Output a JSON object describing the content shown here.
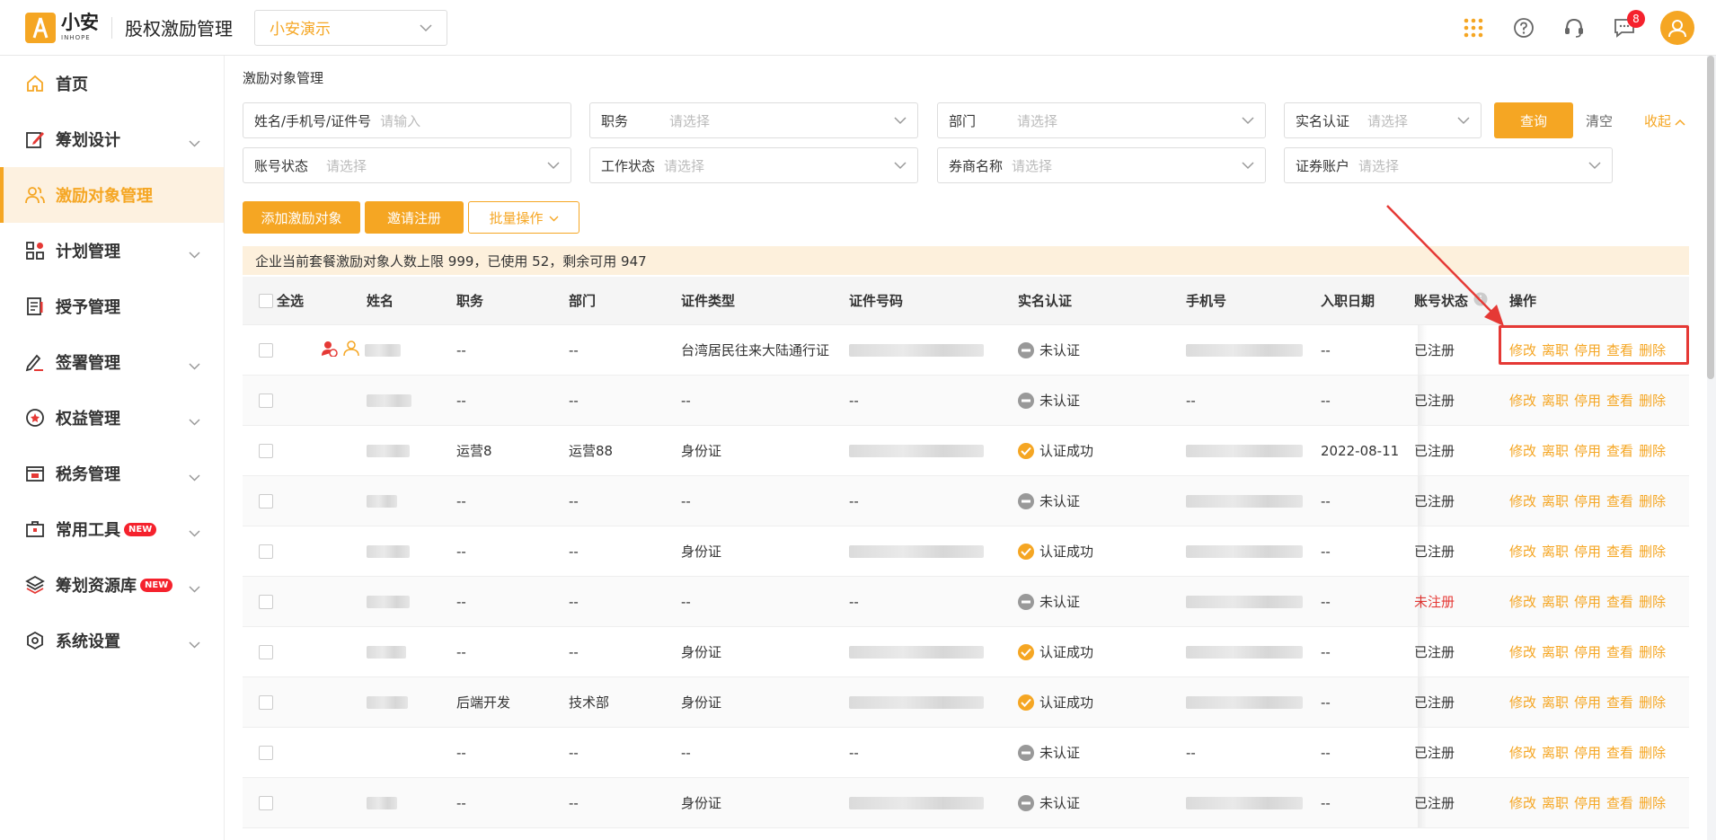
{
  "topbar": {
    "logo_cn": "小安",
    "logo_en": "INHOPE",
    "app_title": "股权激励管理",
    "company": "小安演示",
    "message_count": "8"
  },
  "sidebar": {
    "items": [
      {
        "label": "首页",
        "icon": "home-icon",
        "has_chevron": false,
        "active": false
      },
      {
        "label": "筹划设计",
        "icon": "edit-icon",
        "has_chevron": true,
        "active": false
      },
      {
        "label": "激励对象管理",
        "icon": "users-icon",
        "has_chevron": false,
        "active": true
      },
      {
        "label": "计划管理",
        "icon": "grid-icon",
        "has_chevron": true,
        "active": false
      },
      {
        "label": "授予管理",
        "icon": "document-icon",
        "has_chevron": false,
        "active": false
      },
      {
        "label": "签署管理",
        "icon": "sign-icon",
        "has_chevron": true,
        "active": false
      },
      {
        "label": "权益管理",
        "icon": "star-badge-icon",
        "has_chevron": true,
        "active": false
      },
      {
        "label": "税务管理",
        "icon": "tax-icon",
        "has_chevron": true,
        "active": false
      },
      {
        "label": "常用工具",
        "icon": "toolbox-icon",
        "has_chevron": true,
        "active": false,
        "badge": "NEW"
      },
      {
        "label": "筹划资源库",
        "icon": "layers-icon",
        "has_chevron": true,
        "active": false,
        "badge": "NEW"
      },
      {
        "label": "系统设置",
        "icon": "settings-icon",
        "has_chevron": true,
        "active": false
      }
    ]
  },
  "main": {
    "breadcrumb": "激励对象管理",
    "filters": {
      "name": {
        "label": "姓名/手机号/证件号",
        "placeholder": "请输入"
      },
      "position": {
        "label": "职务",
        "placeholder": "请选择"
      },
      "department": {
        "label": "部门",
        "placeholder": "请选择"
      },
      "realname": {
        "label": "实名认证",
        "placeholder": "请选择"
      },
      "account_status": {
        "label": "账号状态",
        "placeholder": "请选择"
      },
      "work_status": {
        "label": "工作状态",
        "placeholder": "请选择"
      },
      "broker": {
        "label": "券商名称",
        "placeholder": "请选择"
      },
      "securities_account": {
        "label": "证券账户",
        "placeholder": "请选择"
      }
    },
    "query_label": "查询",
    "clear_label": "清空",
    "collapse_label": "收起",
    "actions": {
      "add": "添加激励对象",
      "invite": "邀请注册",
      "batch": "批量操作"
    },
    "notice": "企业当前套餐激励对象人数上限 999，已使用 52，剩余可用 947",
    "table": {
      "headers": {
        "select_all": "全选",
        "name": "姓名",
        "position": "职务",
        "department": "部门",
        "id_type": "证件类型",
        "id_number": "证件号码",
        "realname": "实名认证",
        "phone": "手机号",
        "join_date": "入职日期",
        "account_status": "账号状态",
        "ops": "操作"
      },
      "op_labels": {
        "edit": "修改",
        "leave": "离职",
        "disable": "停用",
        "view": "查看",
        "delete": "删除"
      },
      "rows": [
        {
          "position": "--",
          "department": "--",
          "id_type": "台湾居民往来大陆通行证",
          "id_number": "",
          "realname": "未认证",
          "verified": false,
          "phone": "",
          "join_date": "--",
          "account_status": "已注册",
          "registered": true,
          "special_icons": true
        },
        {
          "position": "--",
          "department": "--",
          "id_type": "--",
          "id_number": "--",
          "realname": "未认证",
          "verified": false,
          "phone": "--",
          "join_date": "--",
          "account_status": "已注册",
          "registered": true
        },
        {
          "position": "运营8",
          "department": "运营88",
          "id_type": "身份证",
          "id_number": "",
          "realname": "认证成功",
          "verified": true,
          "phone": "",
          "join_date": "2022-08-11",
          "account_status": "已注册",
          "registered": true
        },
        {
          "position": "--",
          "department": "--",
          "id_type": "--",
          "id_number": "--",
          "realname": "未认证",
          "verified": false,
          "phone": "",
          "join_date": "--",
          "account_status": "已注册",
          "registered": true
        },
        {
          "position": "--",
          "department": "--",
          "id_type": "身份证",
          "id_number": "",
          "realname": "认证成功",
          "verified": true,
          "phone": "",
          "join_date": "--",
          "account_status": "已注册",
          "registered": true
        },
        {
          "position": "--",
          "department": "--",
          "id_type": "--",
          "id_number": "--",
          "realname": "未认证",
          "verified": false,
          "phone": "",
          "join_date": "--",
          "account_status": "未注册",
          "registered": false
        },
        {
          "position": "--",
          "department": "--",
          "id_type": "身份证",
          "id_number": "",
          "realname": "认证成功",
          "verified": true,
          "phone": "",
          "join_date": "--",
          "account_status": "已注册",
          "registered": true
        },
        {
          "position": "后端开发",
          "department": "技术部",
          "id_type": "身份证",
          "id_number": "",
          "realname": "认证成功",
          "verified": true,
          "phone": "",
          "join_date": "--",
          "account_status": "已注册",
          "registered": true
        },
        {
          "position": "--",
          "department": "--",
          "id_type": "--",
          "id_number": "--",
          "realname": "未认证",
          "verified": false,
          "phone": "--",
          "join_date": "--",
          "account_status": "已注册",
          "registered": true
        },
        {
          "position": "--",
          "department": "--",
          "id_type": "身份证",
          "id_number": "",
          "realname": "未认证",
          "verified": false,
          "phone": "",
          "join_date": "--",
          "account_status": "已注册",
          "registered": true
        }
      ]
    }
  },
  "colors": {
    "accent": "#f5a623",
    "danger": "#e53935",
    "verified": "#f5a623",
    "unverified": "#999999"
  }
}
